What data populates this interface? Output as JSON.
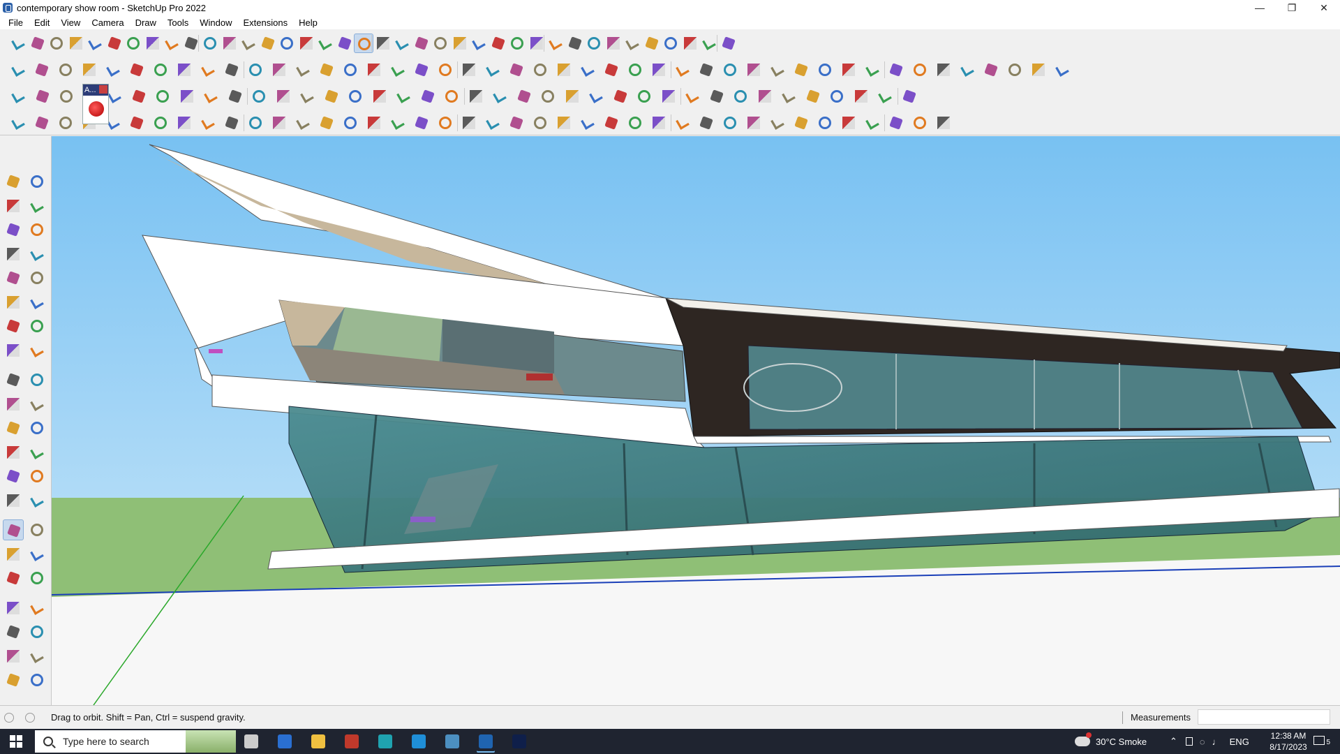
{
  "window": {
    "title": "contemporary show room - SketchUp Pro 2022",
    "minimize": "—",
    "restore": "❐",
    "close": "✕"
  },
  "menu": [
    "File",
    "Edit",
    "View",
    "Camera",
    "Draw",
    "Tools",
    "Window",
    "Extensions",
    "Help"
  ],
  "toolbars": {
    "row1": [
      "zoom-extents-icon",
      "select-icon",
      "select-dropdown-icon",
      "eraser-icon",
      "pencil-line-icon",
      "line-dropdown-icon",
      "arc-icon",
      "arc-dropdown-icon",
      "rectangle-icon",
      "shape-dropdown-icon",
      "push-pull-icon",
      "offset-icon",
      "move-icon",
      "rotate-icon",
      "scale-icon",
      "tape-measure-icon",
      "text-icon",
      "paint-bucket-icon",
      "orbit-icon",
      "pan-icon",
      "zoom-icon",
      "zoom-window-icon",
      "tag-icon",
      "section-icon",
      "layers-icon",
      "solid-icon",
      "warehouse-icon",
      "warehouse-dropdown-icon",
      "extension-icon",
      "component-icon",
      "flag-icon",
      "arrow-up-down-icon",
      "arrow-split-icon",
      "axis-icon",
      "flip-icon",
      "undo-icon",
      "redo-icon",
      "hand-icon"
    ],
    "row2": [
      "cube-gold-icon",
      "cube-blue-icon",
      "cube-green-icon",
      "push-red-icon",
      "move-red-icon",
      "move-blue-icon",
      "arrow-red-icon",
      "arrow-green-icon",
      "arrow-orange-icon",
      "arrow-orange2-icon",
      "arrow-pink-icon",
      "sweep-icon",
      "blue-slash-icon",
      "purple-slash-icon",
      "violet-slash-icon",
      "terrain-icon",
      "terrain-grid-icon",
      "box-open-icon",
      "book-icon",
      "house-icon",
      "shed-icon",
      "house-outline-icon",
      "gate-icon",
      "formula-icon",
      "leaf-icon",
      "ruler-icon",
      "square-shape-icon",
      "circle-shape-icon",
      "hexagon-shape-icon",
      "oval-shape-icon",
      "parallelogram-shape-icon",
      "arc-shape-icon",
      "circle-ring-icon",
      "star-ring-icon",
      "blue-curve-icon",
      "spiral-icon",
      "pink-line-icon",
      "pink-eraser-icon",
      "copper-icon",
      "brick-icon",
      "wave-icon",
      "shelf-icon",
      "mesh-icon",
      "tent-icon",
      "plate-icon"
    ],
    "row3": [
      "panel-blue-icon",
      "panel-blue2-icon",
      "panel-gold-icon",
      "label-popup-icon",
      "arrow-red-popup-icon",
      "flat-panel-icon",
      "spiral-orange-icon",
      "red-frame-icon",
      "grid-frame-icon",
      "corner-frame-icon",
      "roof-icon",
      "pipe-icon",
      "curve-icon",
      "dots-path-icon",
      "plus-red-icon",
      "plus-green-icon",
      "cross-blue-icon",
      "cone-blue-icon",
      "cone-teal-icon",
      "cone-gold-icon",
      "ring-orange-icon",
      "ring-red-icon",
      "ring-blue-icon",
      "star-blue-icon",
      "bucket-icon",
      "red-loop-icon",
      "green-loop-icon",
      "rotate-green-icon",
      "gear-red-icon",
      "gear-pink-icon",
      "gear-gold-icon",
      "net-icon",
      "frame-blue-icon",
      "grid-orange-icon",
      "grid-gold-icon",
      "arrow-cross-icon",
      "dots-arc-icon",
      "grid-dots-icon"
    ],
    "row4": [
      "curve-tool-icon",
      "path-red-icon",
      "red-car-icon",
      "cube-sketch-icon",
      "cube-wire-icon",
      "sheet-icon",
      "bent-icon",
      "pretzel-icon",
      "star-sketch-icon",
      "ribbon-icon",
      "bend-icon",
      "angle-icon",
      "red-line-icon",
      "brush-icon",
      "basket-icon",
      "slope-icon",
      "pillar-icon",
      "column-icon",
      "hand-wire-icon",
      "wave-paper-icon",
      "arrow-pointer-icon",
      "stack-icon",
      "stripes-icon",
      "fold-icon",
      "blade-icon",
      "blade2-icon",
      "road-icon",
      "stair-icon",
      "ramp-icon",
      "roof-black-icon",
      "steps-icon",
      "cage-icon",
      "grid-black-icon",
      "bars-icon",
      "wall-icon",
      "net-black-icon",
      "globe-net-icon",
      "spike-icon",
      "spike2-icon",
      "house-wire-icon"
    ]
  },
  "label_popup": "A...",
  "left_toolbar": [
    "select-icon",
    "orbit-icon",
    "paint-bucket-icon",
    "eraser-icon",
    "component-icon",
    "tape-measure-icon",
    "line-icon",
    "freehand-icon",
    "rectangle-icon",
    "rotated-rectangle-icon",
    "circle-icon",
    "polygon-icon",
    "arc-icon",
    "pie-icon",
    "3point-arc-icon",
    "2point-arc-icon",
    "move-icon",
    "push-pull-icon",
    "rotate-icon",
    "follow-me-icon",
    "scale-icon",
    "offset-icon",
    "tape-icon",
    "dimension-icon",
    "protractor-icon",
    "text-icon",
    "axes-icon",
    "3d-text-icon",
    "orbit-active-icon",
    "pan-icon",
    "zoom-icon",
    "zoom-window-icon",
    "zoom-extents-icon",
    "previous-view-icon",
    "position-camera-icon",
    "look-around-icon",
    "walk-icon",
    "section-plane-icon",
    "display-section-icon",
    "section-cut-icon",
    "section-fill-icon",
    "scenes-icon"
  ],
  "status": {
    "message": "Drag to orbit. Shift = Pan, Ctrl = suspend gravity.",
    "measurements_label": "Measurements",
    "measurements_value": ""
  },
  "taskbar": {
    "search_placeholder": "Type here to search",
    "weather": "30°C  Smoke",
    "lang": "ENG",
    "time": "12:38 AM",
    "date": "8/17/2023",
    "notification_count": "5",
    "apps": [
      "task-view-icon",
      "calculator-icon",
      "file-explorer-icon",
      "acrobat-icon",
      "3dsmax-icon",
      "edge-icon",
      "snipping-icon",
      "sketchup-icon",
      "photoshop-icon"
    ]
  },
  "colors": {
    "sky_top": "#7fc4f3",
    "sky_bottom": "#a9d7f6",
    "ground": "#8fbf76",
    "glass": "#3d7a7e",
    "dark_frame": "#2e2622",
    "white_slab": "#ffffff"
  }
}
